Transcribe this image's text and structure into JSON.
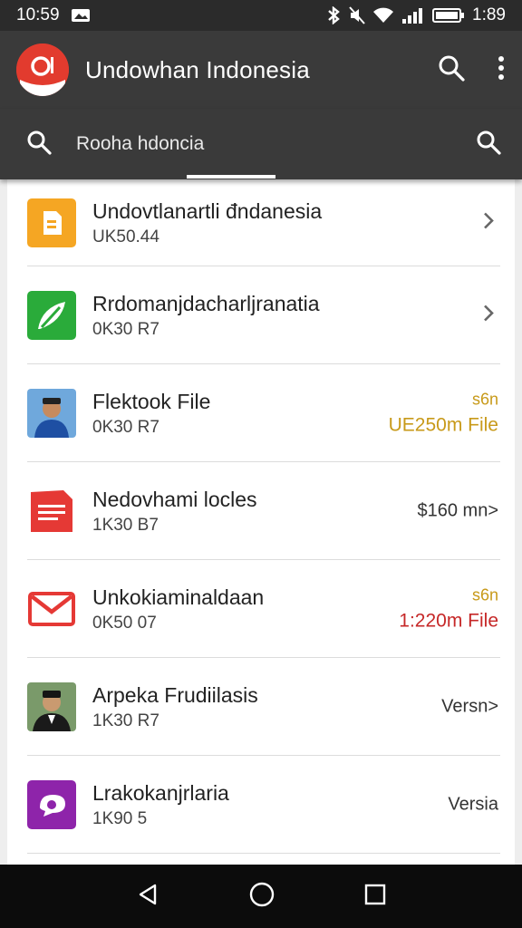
{
  "status": {
    "time": "10:59",
    "battery_time": "1:89"
  },
  "app": {
    "title": "Undowhan Indonesia",
    "brand_color": "#e23b2e"
  },
  "search": {
    "query": "Rooha hdoncia"
  },
  "items": [
    {
      "title": "Undovtlanartli đndanesia",
      "subtitle": "UK50.44",
      "right_top": "",
      "right_bottom": "",
      "icon": "document-icon",
      "icon_color": "#f5a623",
      "chevron": true
    },
    {
      "title": "Rrdomanjdacharljranatia",
      "subtitle": "0K30 R7",
      "right_top": "",
      "right_bottom": "",
      "icon": "leaf-icon",
      "icon_color": "#2aab3a",
      "chevron": true
    },
    {
      "title": "Flektook File",
      "subtitle": "0K30 R7",
      "right_top": "s6n",
      "right_bottom": "UE250m File",
      "right_bottom_color": "#c89a1a",
      "icon": "person-avatar",
      "chevron": false
    },
    {
      "title": "Nedovhami locles",
      "subtitle": "1K30 B7",
      "right_top": "",
      "right_bottom": "$160 mn>",
      "right_bottom_color": "#333333",
      "icon": "pdf-icon",
      "icon_color": "#e53935",
      "chevron": false
    },
    {
      "title": "Unkokiaminaldaan",
      "subtitle": "0K50 07",
      "right_top": "s6n",
      "right_bottom": "1:220m File",
      "right_bottom_color": "#c62828",
      "icon": "mail-icon",
      "chevron": false
    },
    {
      "title": "Arpeka Frudiilasis",
      "subtitle": "1K30 R7",
      "right_top": "",
      "right_bottom": "Versn>",
      "right_bottom_color": "#333333",
      "icon": "person-avatar",
      "chevron": false
    },
    {
      "title": "Lrakokanjrlaria",
      "subtitle": "1K90 5",
      "right_top": "",
      "right_bottom": "Versia",
      "right_bottom_color": "#333333",
      "icon": "chat-icon",
      "icon_color": "#8e24aa",
      "chevron": false
    }
  ]
}
